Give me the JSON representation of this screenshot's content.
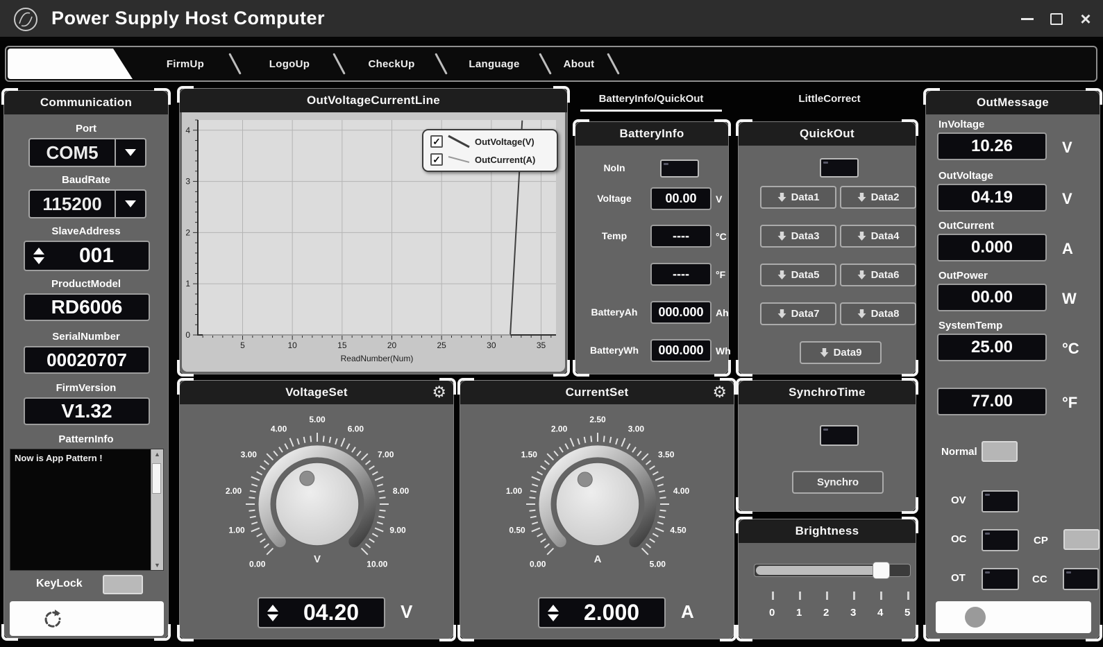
{
  "window": {
    "title": "Power Supply Host Computer",
    "close_glyph": "×"
  },
  "menu": {
    "tabs": [
      {
        "label": "",
        "active": true
      },
      {
        "label": "FirmUp"
      },
      {
        "label": "LogoUp"
      },
      {
        "label": "CheckUp"
      },
      {
        "label": "Language"
      },
      {
        "label": "About"
      }
    ]
  },
  "communication": {
    "title": "Communication",
    "fields": [
      {
        "label": "Port",
        "value": "COM5"
      },
      {
        "label": "BaudRate",
        "value": "115200"
      },
      {
        "label": "SlaveAddress",
        "value": "001"
      },
      {
        "label": "ProductModel",
        "value": "RD6006"
      },
      {
        "label": "SerialNumber",
        "value": "00020707"
      },
      {
        "label": "FirmVersion",
        "value": "V1.32"
      }
    ],
    "pattern_label": "PatternInfo",
    "pattern_text": "Now is App Pattern !",
    "keylock_label": "KeyLock"
  },
  "right_tabs": {
    "active": "BatteryInfo/QuickOut",
    "inactive": "LittleCorrect"
  },
  "chart_data": {
    "type": "line",
    "title": "OutVoltageCurrentLine",
    "xlabel": "ReadNumber(Num)",
    "ylabel": "",
    "xlim": [
      0.5,
      36.5
    ],
    "ylim": [
      0,
      4.2
    ],
    "x_ticks": [
      5,
      10,
      15,
      20,
      25,
      30,
      35
    ],
    "y_ticks": [
      0,
      1,
      2,
      3,
      4
    ],
    "grid": true,
    "plot_bg": "#dcdcdc",
    "legend_position": "top-right",
    "legend": [
      {
        "label": "OutVoltage(V)",
        "checked": true
      },
      {
        "label": "OutCurrent(A)",
        "checked": true
      }
    ],
    "series": [
      {
        "name": "OutVoltage(V)",
        "color": "#3f3f3f",
        "points": [
          [
            1,
            0
          ],
          [
            31.9,
            0
          ],
          [
            33.1,
            4.19
          ]
        ]
      },
      {
        "name": "OutCurrent(A)",
        "color": "#9a9a9a",
        "points": [
          [
            1,
            0
          ],
          [
            31.9,
            0
          ]
        ]
      }
    ]
  },
  "battery_info": {
    "title": "BatteryInfo",
    "rows": [
      {
        "label": "NoIn",
        "type": "indicator",
        "state": "off"
      },
      {
        "label": "Voltage",
        "value": "00.00",
        "unit": "V"
      },
      {
        "label": "Temp",
        "value": "----",
        "unit": "°C"
      },
      {
        "label": "",
        "value": "----",
        "unit": "°F"
      },
      {
        "label": "BatteryAh",
        "value": "000.000",
        "unit": "Ah"
      },
      {
        "label": "BatteryWh",
        "value": "000.000",
        "unit": "Wh"
      }
    ]
  },
  "quick_out": {
    "title": "QuickOut",
    "indicator_state": "off",
    "buttons": [
      "Data1",
      "Data2",
      "Data3",
      "Data4",
      "Data5",
      "Data6",
      "Data7",
      "Data8",
      "Data9"
    ]
  },
  "voltage_set": {
    "title": "VoltageSet",
    "scale": [
      "0.00",
      "1.00",
      "2.00",
      "3.00",
      "4.00",
      "5.00",
      "6.00",
      "7.00",
      "8.00",
      "9.00",
      "10.00"
    ],
    "value": "04.20",
    "unit": "V"
  },
  "current_set": {
    "title": "CurrentSet",
    "scale": [
      "0.00",
      "0.50",
      "1.00",
      "1.50",
      "2.00",
      "2.50",
      "3.00",
      "3.50",
      "4.00",
      "4.50",
      "5.00"
    ],
    "value": "2.000",
    "unit": "A"
  },
  "synchro_time": {
    "title": "SynchroTime",
    "button": "Synchro",
    "indicator_state": "off"
  },
  "brightness": {
    "title": "Brightness",
    "ticks": [
      "0",
      "1",
      "2",
      "3",
      "4",
      "5"
    ],
    "value": 4,
    "max": 5
  },
  "out_message": {
    "title": "OutMessage",
    "fields": [
      {
        "label": "InVoltage",
        "value": "10.26",
        "unit": "V"
      },
      {
        "label": "OutVoltage",
        "value": "04.19",
        "unit": "V"
      },
      {
        "label": "OutCurrent",
        "value": "0.000",
        "unit": "A"
      },
      {
        "label": "OutPower",
        "value": "00.00",
        "unit": "W"
      },
      {
        "label": "SystemTemp",
        "value": "25.00",
        "unit": "°C"
      },
      {
        "label": "",
        "value": "77.00",
        "unit": "°F"
      }
    ],
    "status": [
      {
        "label": "Normal",
        "on": true
      },
      {
        "label": "OV",
        "on": false
      },
      {
        "label": "OC",
        "on": false
      },
      {
        "label": "CP",
        "on": true
      },
      {
        "label": "OT",
        "on": false
      },
      {
        "label": "CC",
        "on": false
      }
    ]
  }
}
